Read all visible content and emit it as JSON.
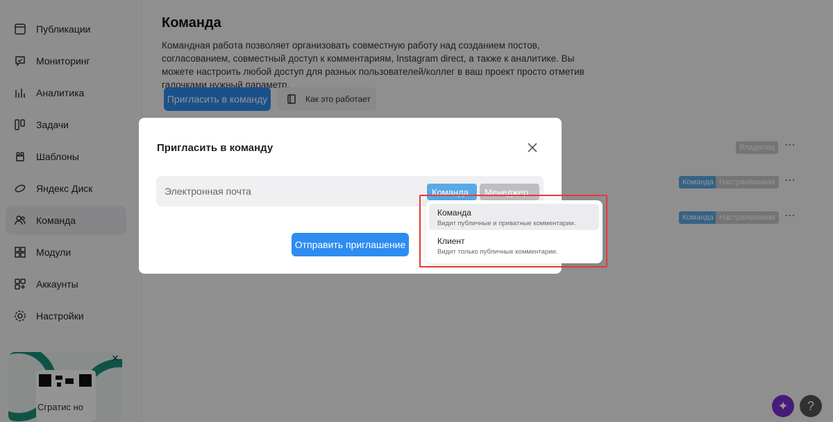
{
  "sidebar": {
    "items": [
      {
        "label": "Публикации",
        "icon": "publications-icon"
      },
      {
        "label": "Мониторинг",
        "icon": "monitoring-icon"
      },
      {
        "label": "Аналитика",
        "icon": "analytics-icon"
      },
      {
        "label": "Задачи",
        "icon": "tasks-icon"
      },
      {
        "label": "Шаблоны",
        "icon": "templates-icon"
      },
      {
        "label": "Яндекс Диск",
        "icon": "yandex-disk-icon"
      },
      {
        "label": "Команда",
        "icon": "team-icon"
      },
      {
        "label": "Модули",
        "icon": "modules-icon"
      },
      {
        "label": "Аккаунты",
        "icon": "accounts-icon"
      },
      {
        "label": "Настройки",
        "icon": "settings-icon"
      }
    ],
    "active": "Команда",
    "promo_text": "Сгратис но"
  },
  "main": {
    "title": "Команда",
    "description": "Командная работа позволяет организовать совместную работу над созданием постов, согласованием, совместный доступ к комментариям, Instagram direct, а также к аналитике. Вы можете настроить любой доступ для разных пользователей/коллег в ваш проект просто отметив галочками нужный параметр.",
    "invite_button": "Пригласить в команду",
    "how_button": "Как это работает",
    "rows": [
      {
        "tags": [
          "Владелец"
        ]
      },
      {
        "tags": [
          "Команда",
          "Настраиваемая"
        ]
      },
      {
        "tags": [
          "Команда",
          "Настраиваемая"
        ]
      }
    ],
    "more": "⋯"
  },
  "modal": {
    "title": "Пригласить в команду",
    "email_placeholder": "Электронная почта",
    "type_chip": "Команда",
    "role_chip": "Менеджер",
    "send_button": "Отправить приглашение"
  },
  "dropdown": {
    "options": [
      {
        "label": "Команда",
        "sub": "Видит публичные и приватные комментарии."
      },
      {
        "label": "Клиент",
        "sub": "Видит только публичные комментарии."
      }
    ]
  },
  "fab": {
    "help": "?"
  },
  "colors": {
    "accent": "#2d8cf0",
    "tag_blue": "#5aa9e6",
    "highlight": "#e53935"
  }
}
